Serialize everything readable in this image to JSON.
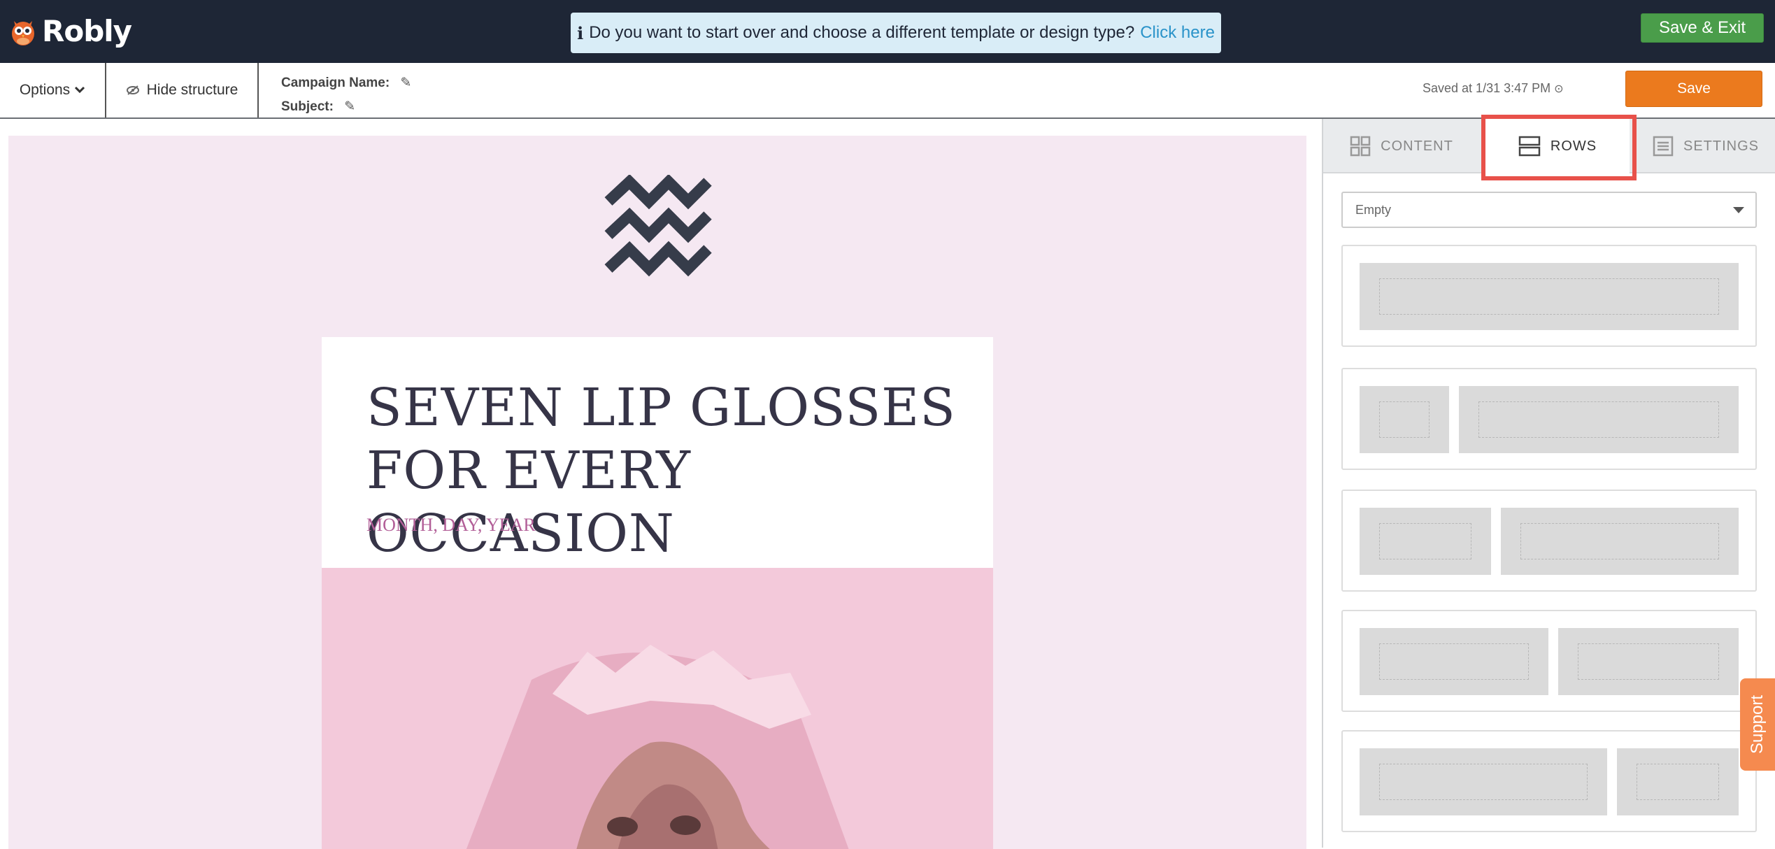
{
  "app": {
    "name": "Robly"
  },
  "notice": {
    "icon": "info-icon",
    "text": "Do you want to start over and choose a different template or design type?",
    "link": "Click here"
  },
  "header": {
    "save_exit_label": "Save & Exit"
  },
  "toolbar": {
    "options_label": "Options",
    "hide_structure_label": "Hide structure",
    "campaign_name_label": "Campaign Name:",
    "subject_label": "Subject:",
    "saved_at": "Saved at 1/31 3:47 PM",
    "save_label": "Save"
  },
  "email": {
    "headline_line1": "SEVEN LIP GLOSSES",
    "headline_line2": "FOR EVERY OCCASION",
    "date": "MONTH, DAY, YEAR",
    "background_color": "#f5e8f2",
    "headline_color": "#363447",
    "date_color": "#b25f98"
  },
  "panel": {
    "tabs": [
      {
        "label": "CONTENT",
        "icon": "grid-icon"
      },
      {
        "label": "ROWS",
        "icon": "rows-icon"
      },
      {
        "label": "SETTINGS",
        "icon": "settings-list-icon"
      }
    ],
    "active_tab": "ROWS",
    "dropdown_value": "Empty",
    "row_layouts": [
      "1 column",
      "1/6 + 5/6",
      "1/3 + 2/3",
      "1/2 + 1/2",
      "2/3 + 1/3"
    ]
  },
  "support": {
    "label": "Support"
  },
  "colors": {
    "topbar": "#1e2636",
    "save_exit": "#4a9d4a",
    "save": "#eb7a1e",
    "highlight": "#e8514a",
    "support": "#f58a4f"
  }
}
